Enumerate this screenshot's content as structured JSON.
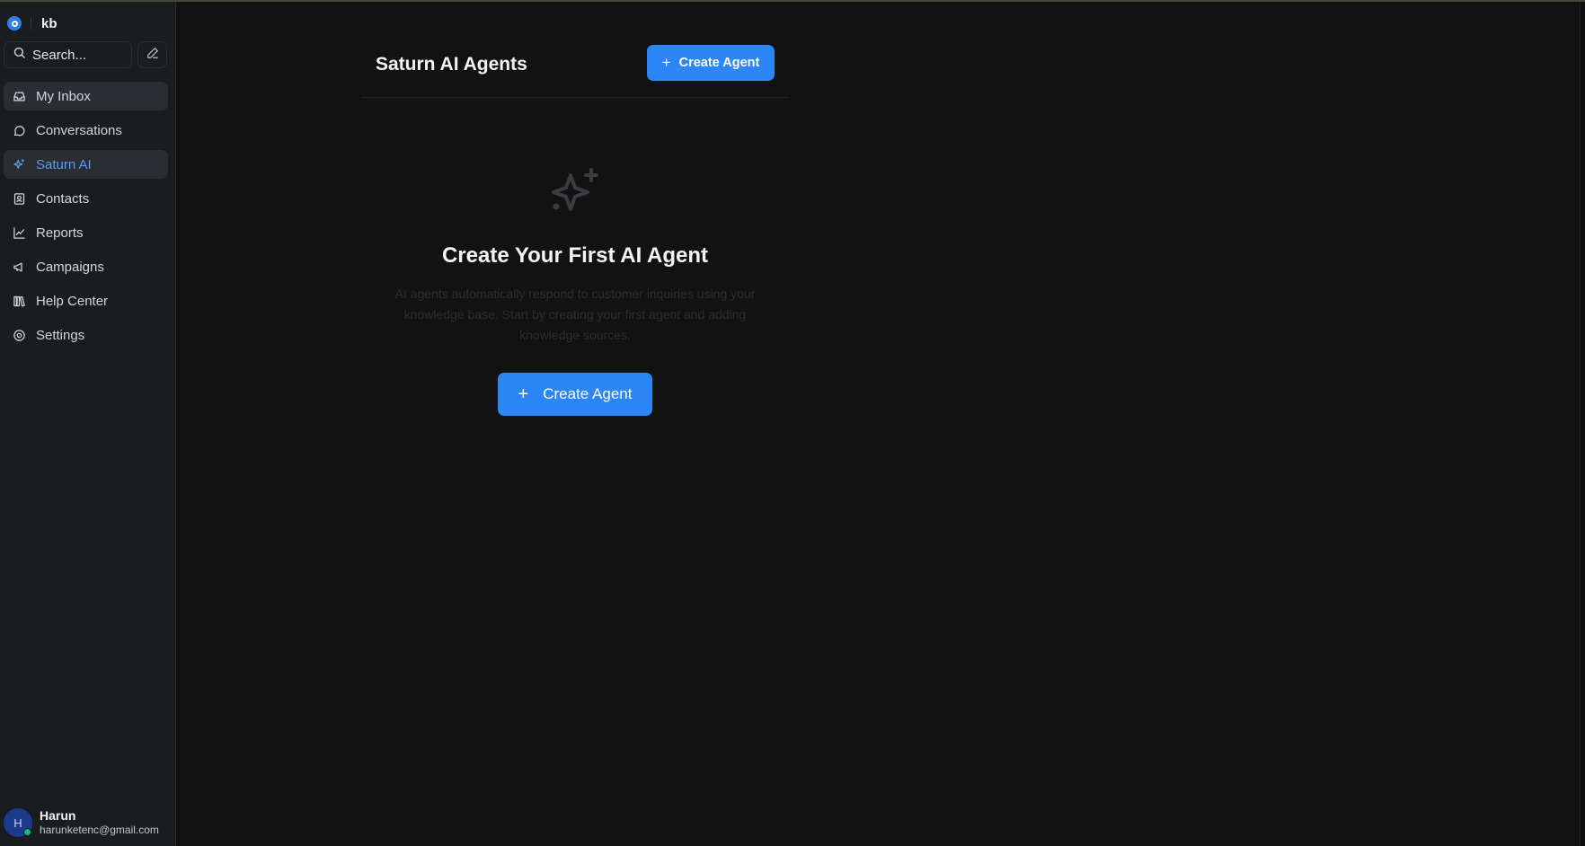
{
  "workspace": {
    "name": "kb"
  },
  "search": {
    "placeholder": "Search..."
  },
  "sidebar": {
    "items": [
      {
        "label": "My Inbox",
        "icon": "inbox-icon"
      },
      {
        "label": "Conversations",
        "icon": "chat-bubble-icon"
      },
      {
        "label": "Saturn AI",
        "icon": "sparkle-icon"
      },
      {
        "label": "Contacts",
        "icon": "contact-card-icon"
      },
      {
        "label": "Reports",
        "icon": "line-chart-icon"
      },
      {
        "label": "Campaigns",
        "icon": "megaphone-icon"
      },
      {
        "label": "Help Center",
        "icon": "books-icon"
      },
      {
        "label": "Settings",
        "icon": "gear-icon"
      }
    ]
  },
  "user": {
    "initial": "H",
    "name": "Harun",
    "email": "harunketenc@gmail.com"
  },
  "header": {
    "title": "Saturn AI Agents",
    "create_label": "Create Agent"
  },
  "empty_state": {
    "title": "Create Your First AI Agent",
    "description": "AI agents automatically respond to customer inquiries using your knowledge base. Start by creating your first agent and adding knowledge sources.",
    "button_label": "Create Agent"
  },
  "colors": {
    "accent": "#2d86f5",
    "active_nav": "#5b9cf5",
    "background": "#121212",
    "sidebar": "#1b1c1f"
  }
}
